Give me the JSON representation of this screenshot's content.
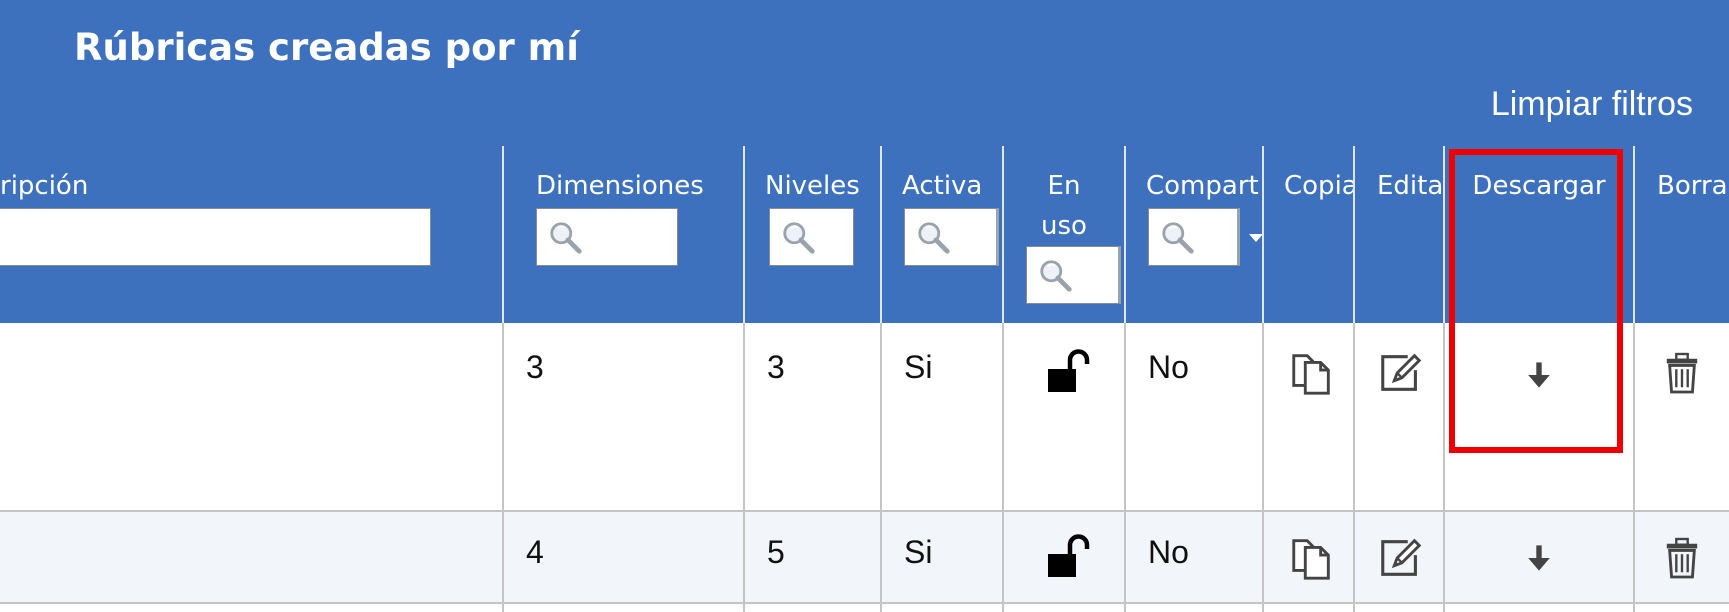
{
  "header": {
    "title": "Rúbricas creadas por mí",
    "clear_filters": "Limpiar filtros"
  },
  "columns": {
    "descripcion": "ripción",
    "dimensiones": "Dimensiones",
    "niveles": "Niveles",
    "activa": "Activa",
    "en_uso": "En uso",
    "compartida": "Compart",
    "copiar": "Copia",
    "editar": "Edita",
    "descargar": "Descargar",
    "borrar": "Borra"
  },
  "rows": [
    {
      "dimensiones": "3",
      "niveles": "3",
      "activa": "Si",
      "compartida": "No",
      "en_uso_icon": "unlocked-padlock-icon"
    },
    {
      "dimensiones": "4",
      "niveles": "5",
      "activa": "Si",
      "compartida": "No",
      "en_uso_icon": "unlocked-padlock-icon"
    }
  ],
  "colors": {
    "header_blue": "#3d71be",
    "highlight_red": "#ee0000",
    "alt_row": "#f2f5f9"
  }
}
